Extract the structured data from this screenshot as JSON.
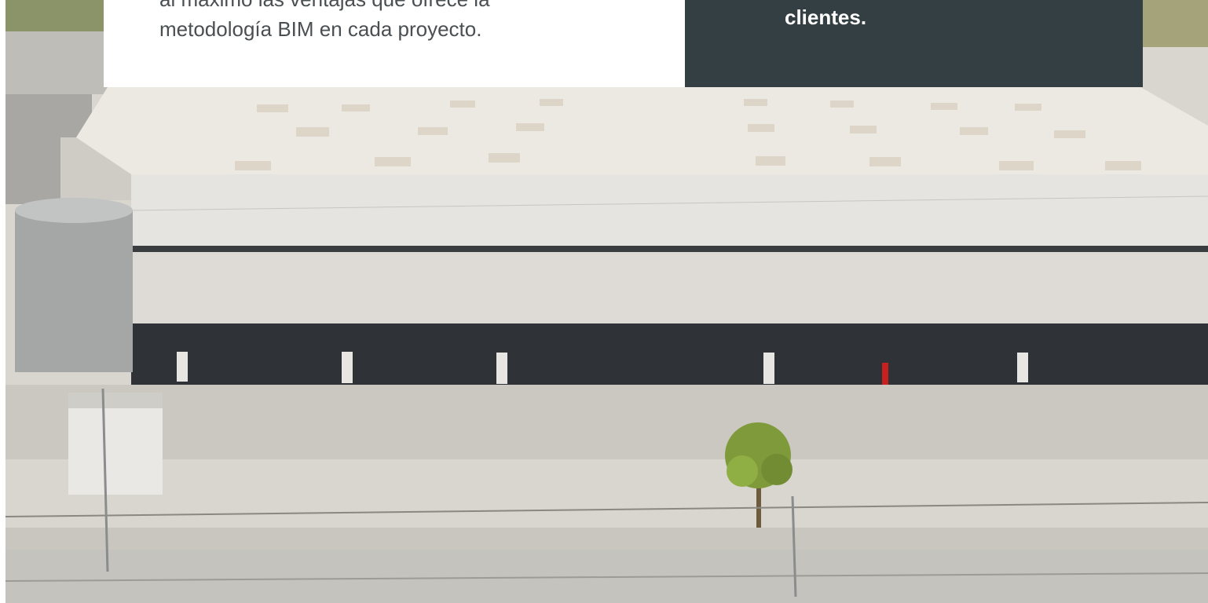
{
  "left_card": {
    "line_1": "al máximo las ventajas que ofrece la",
    "line_2": "metodología BIM en cada proyecto."
  },
  "right_card": {
    "text": "clientes."
  },
  "colors": {
    "dark_card": "#343f44",
    "body_text": "#4a4f52"
  }
}
